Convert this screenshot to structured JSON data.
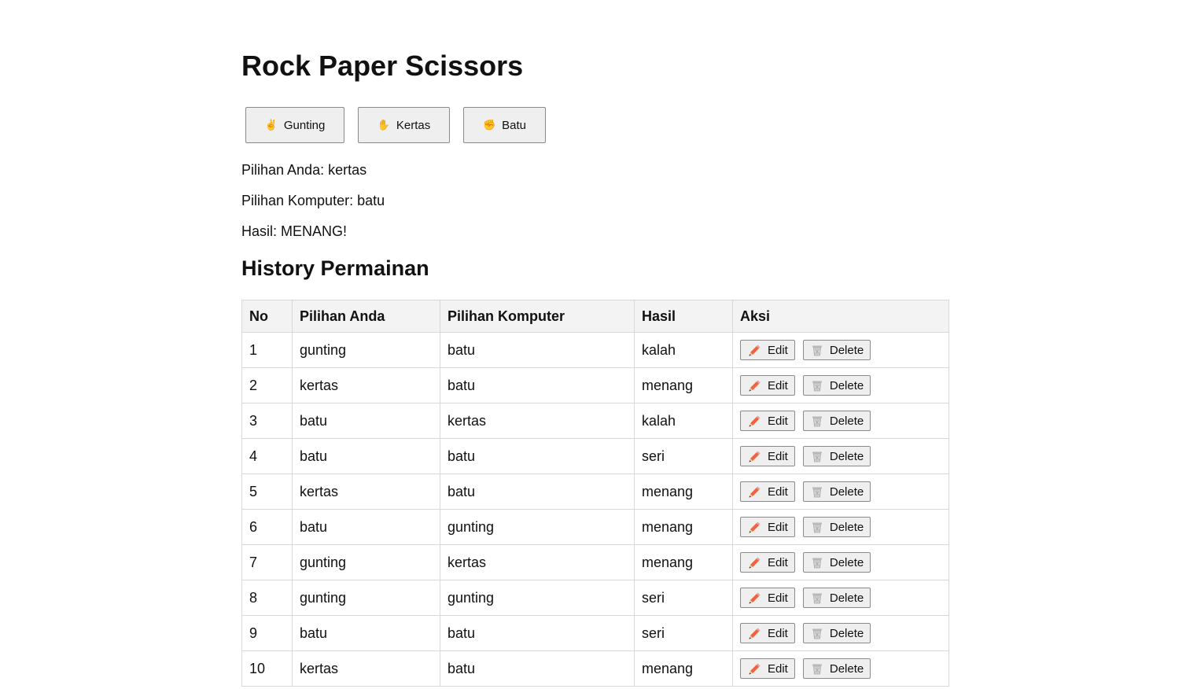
{
  "title": "Rock Paper Scissors",
  "choices": [
    {
      "emoji": "✌",
      "label": "Gunting"
    },
    {
      "emoji": "✋",
      "label": "Kertas"
    },
    {
      "emoji": "✊",
      "label": "Batu"
    }
  ],
  "result": {
    "player": "Pilihan Anda: kertas",
    "computer": "Pilihan Komputer: batu",
    "outcome": "Hasil: MENANG!"
  },
  "history": {
    "title": "History Permainan",
    "headers": [
      "No",
      "Pilihan Anda",
      "Pilihan Komputer",
      "Hasil",
      "Aksi"
    ],
    "edit_label": "Edit",
    "delete_label": "Delete",
    "rows": [
      {
        "no": "1",
        "anda": "gunting",
        "komputer": "batu",
        "hasil": "kalah"
      },
      {
        "no": "2",
        "anda": "kertas",
        "komputer": "batu",
        "hasil": "menang"
      },
      {
        "no": "3",
        "anda": "batu",
        "komputer": "kertas",
        "hasil": "kalah"
      },
      {
        "no": "4",
        "anda": "batu",
        "komputer": "batu",
        "hasil": "seri"
      },
      {
        "no": "5",
        "anda": "kertas",
        "komputer": "batu",
        "hasil": "menang"
      },
      {
        "no": "6",
        "anda": "batu",
        "komputer": "gunting",
        "hasil": "menang"
      },
      {
        "no": "7",
        "anda": "gunting",
        "komputer": "kertas",
        "hasil": "menang"
      },
      {
        "no": "8",
        "anda": "gunting",
        "komputer": "gunting",
        "hasil": "seri"
      },
      {
        "no": "9",
        "anda": "batu",
        "komputer": "batu",
        "hasil": "seri"
      },
      {
        "no": "10",
        "anda": "kertas",
        "komputer": "batu",
        "hasil": "menang"
      }
    ]
  },
  "icons": {
    "edit": "pencil-icon",
    "delete": "trash-icon"
  }
}
